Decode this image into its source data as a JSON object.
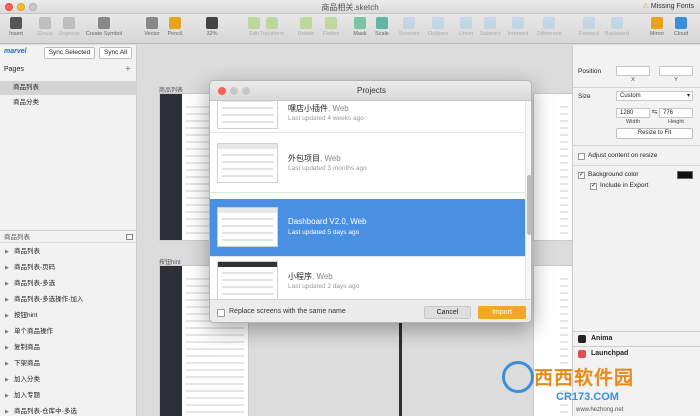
{
  "window": {
    "title": "商品相关.sketch",
    "missing_fonts": "Missing Fonts"
  },
  "toolbar": {
    "items": [
      {
        "label": "Insert",
        "icon": "insert-icon",
        "color": "#555555"
      },
      {
        "label": "Group",
        "icon": "group-icon",
        "color": "#999999"
      },
      {
        "label": "Ungroup",
        "icon": "ungroup-icon",
        "color": "#999999"
      },
      {
        "label": "Create Symbol",
        "icon": "create-symbol-icon",
        "color": "#888888"
      },
      {
        "label": "Vector",
        "icon": "vector-icon",
        "color": "#888888"
      },
      {
        "label": "Pencil",
        "icon": "pencil-icon",
        "color": "#e8a21b"
      },
      {
        "label": "32%",
        "icon": "zoom-icon",
        "color": "#444444"
      },
      {
        "label": "Edit",
        "icon": "edit-icon",
        "color": "#9ccb5a"
      },
      {
        "label": "Transform",
        "icon": "transform-icon",
        "color": "#9ccb5a"
      },
      {
        "label": "Rotate",
        "icon": "rotate-icon",
        "color": "#9ccb5a"
      },
      {
        "label": "Flatten",
        "icon": "flatten-icon",
        "color": "#9ccb5a"
      },
      {
        "label": "Mask",
        "icon": "mask-icon",
        "color": "#7cc4a8"
      },
      {
        "label": "Scale",
        "icon": "scale-icon",
        "color": "#62b5a3"
      },
      {
        "label": "Scissors",
        "icon": "scissors-icon",
        "color": "#a8c8e8"
      },
      {
        "label": "Outlines",
        "icon": "outlines-icon",
        "color": "#a8c8e8"
      },
      {
        "label": "Union",
        "icon": "union-icon",
        "color": "#a8c8e8"
      },
      {
        "label": "Subtract",
        "icon": "subtract-icon",
        "color": "#a8c8e8"
      },
      {
        "label": "Intersect",
        "icon": "intersect-icon",
        "color": "#a8c8e8"
      },
      {
        "label": "Difference",
        "icon": "difference-icon",
        "color": "#a8c8e8"
      },
      {
        "label": "Forward",
        "icon": "forward-icon",
        "color": "#a8c8e8"
      },
      {
        "label": "Backward",
        "icon": "backward-icon",
        "color": "#a8c8e8"
      },
      {
        "label": "Mirror",
        "icon": "mirror-icon",
        "color": "#e8a21b"
      },
      {
        "label": "Cloud",
        "icon": "cloud-icon",
        "color": "#3a8fd8"
      }
    ]
  },
  "left_panel": {
    "brand": "marvel",
    "sync_selected": "Sync Selected",
    "sync_all": "Sync All",
    "pages_header": "Pages",
    "pages": [
      "商品列表",
      "商品分类"
    ],
    "layers_header": "商品列表",
    "layers": [
      "商品列表",
      "商品列表-页码",
      "商品列表-多选",
      "商品列表-多选操作-加入",
      "按钮hint",
      "单个商品操作",
      "复制商品",
      "下架商品",
      "加入分类",
      "加入专题",
      "商品列表-仓库中-多选",
      "商品列表-仓库中-上架商品"
    ]
  },
  "canvas": {
    "artboard_1_label": "商品列表",
    "artboard_2_label": "按钮hint"
  },
  "right_panel": {
    "position_label": "Position",
    "x_label": "X",
    "y_label": "Y",
    "size_label": "Size",
    "size_preset": "Custom",
    "width_value": "1280",
    "height_value": "776",
    "width_label": "Width",
    "height_label": "Height",
    "resize_to_fit": "Resize to Fit",
    "adjust_content": "Adjust content on resize",
    "background_color": "Background color",
    "include_in_export": "Include in Export",
    "plugin_anima": "Anima",
    "plugin_launchpad": "Launchpad"
  },
  "dialog": {
    "title": "Projects",
    "projects": [
      {
        "name": "嘿店小插件",
        "kind": ", Web",
        "updated": "Last updated 4 weeks ago",
        "selected": false
      },
      {
        "name": "外包项目",
        "kind": ", Web",
        "updated": "Last updated 3 months ago",
        "selected": false
      },
      {
        "name": "Dashboard V2.0",
        "kind": ", Web",
        "updated": "Last updated 5 days ago",
        "selected": true
      },
      {
        "name": "小程序",
        "kind": ", Web",
        "updated": "Last updated 2 days ago",
        "selected": false
      }
    ],
    "replace_label": "Replace screens with the same name",
    "cancel": "Cancel",
    "import": "Import",
    "accent_color": "#4a90e2",
    "import_color": "#f5a623"
  },
  "watermark": {
    "title": "西西软件园",
    "subtitle": "CR173.COM",
    "url": "www.hezhong.net"
  }
}
